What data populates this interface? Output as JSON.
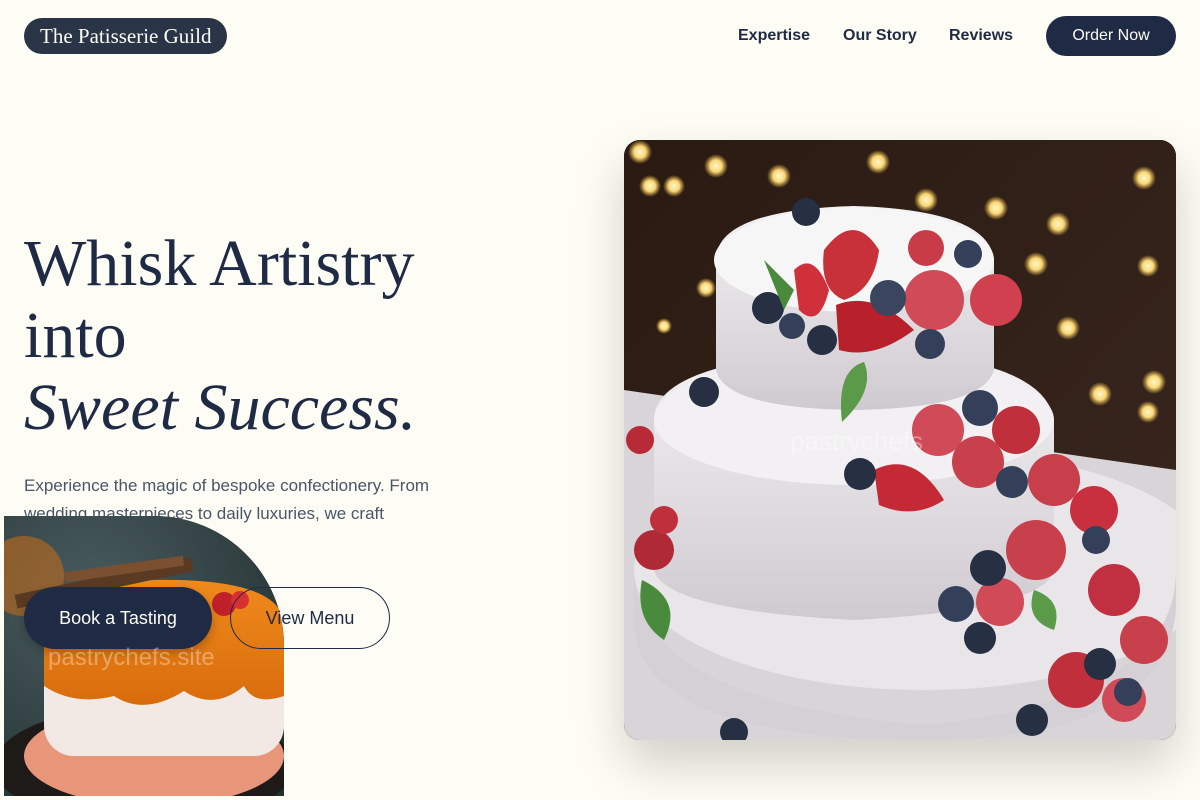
{
  "nav": {
    "logo": "The Patisserie Guild",
    "links": [
      "Expertise",
      "Our Story",
      "Reviews"
    ],
    "cta": "Order Now"
  },
  "hero": {
    "headline_line1": "Whisk Artistry",
    "headline_line2": "into",
    "headline_line3": "Sweet Success.",
    "subtext": "Experience the magic of bespoke confectionery. From wedding masterpieces to daily luxuries, we craft memories you can taste.",
    "primary_button": "Book a Tasting",
    "secondary_button": "View Menu"
  },
  "images": {
    "main_watermark": "pastrychefs",
    "small_watermark": "pastrychefs.site"
  },
  "colors": {
    "background": "#fdfdf5",
    "navy": "#1f2a44",
    "text_muted": "#4a5568"
  }
}
